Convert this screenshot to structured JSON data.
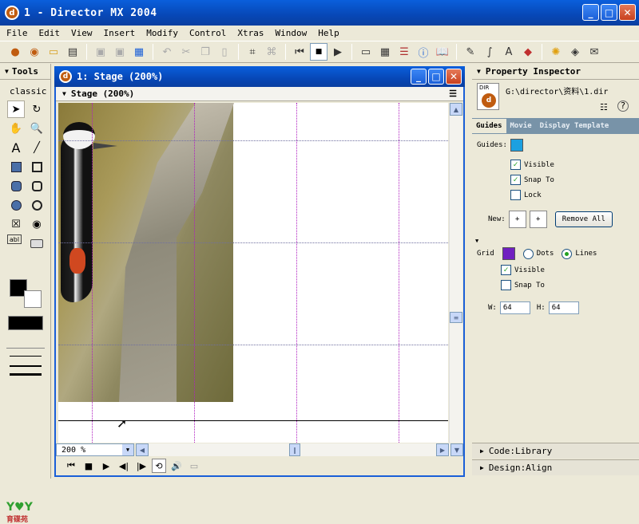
{
  "window": {
    "title": "1 - Director MX 2004",
    "app_icon": "director-logo-icon"
  },
  "menu": [
    "File",
    "Edit",
    "View",
    "Insert",
    "Modify",
    "Control",
    "Xtras",
    "Window",
    "Help"
  ],
  "tools": {
    "title": "Tools",
    "mode": "classic",
    "logo_text": "育碟苑"
  },
  "stage": {
    "window_title": "1: Stage (200%)",
    "sub_title": "Stage (200%)",
    "zoom": "200 %"
  },
  "inspector": {
    "title": "Property Inspector",
    "file_path": "G:\\director\\资料\\1.dir",
    "file_badge": "DIR",
    "tabs": [
      "Guides",
      "Movie",
      "Display Template"
    ],
    "guides": {
      "label": "Guides:",
      "color": "#1ca0e0",
      "visible": "Visible",
      "snap": "Snap To",
      "lock": "Lock",
      "new_label": "New:",
      "remove_all": "Remove All"
    },
    "grid": {
      "label": "Grid",
      "color": "#7020c0",
      "dots": "Dots",
      "lines": "Lines",
      "visible": "Visible",
      "snap": "Snap To",
      "w_label": "W:",
      "w": "64",
      "h_label": "H:",
      "h": "64"
    },
    "panels": [
      "Code:Library",
      "Design:Align"
    ]
  }
}
